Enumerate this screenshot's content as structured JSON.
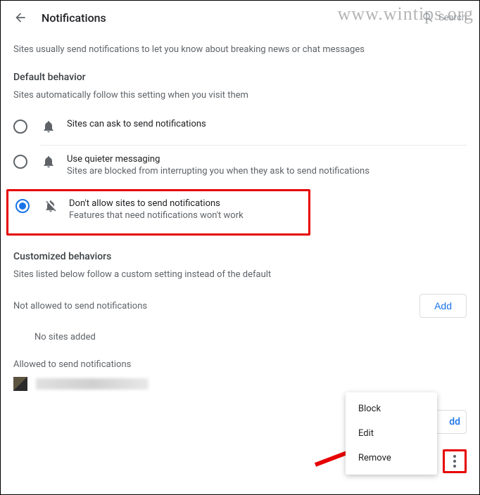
{
  "header": {
    "title": "Notifications",
    "search_placeholder": "Search"
  },
  "intro": "Sites usually send notifications to let you know about breaking news or chat messages",
  "default_behavior": {
    "title": "Default behavior",
    "subtitle": "Sites automatically follow this setting when you visit them",
    "options": [
      {
        "label": "Sites can ask to send notifications",
        "sub": ""
      },
      {
        "label": "Use quieter messaging",
        "sub": "Sites are blocked from interrupting you when they ask to send notifications"
      },
      {
        "label": "Don't allow sites to send notifications",
        "sub": "Features that need notifications won't work"
      }
    ],
    "selected_index": 2
  },
  "customized": {
    "title": "Customized behaviors",
    "subtitle": "Sites listed below follow a custom setting instead of the default"
  },
  "not_allowed": {
    "label": "Not allowed to send notifications",
    "add_label": "Add",
    "empty": "No sites added"
  },
  "allowed": {
    "label": "Allowed to send notifications",
    "add_label": "dd"
  },
  "context_menu": {
    "block": "Block",
    "edit": "Edit",
    "remove": "Remove"
  },
  "watermark": "www.wintips.org"
}
